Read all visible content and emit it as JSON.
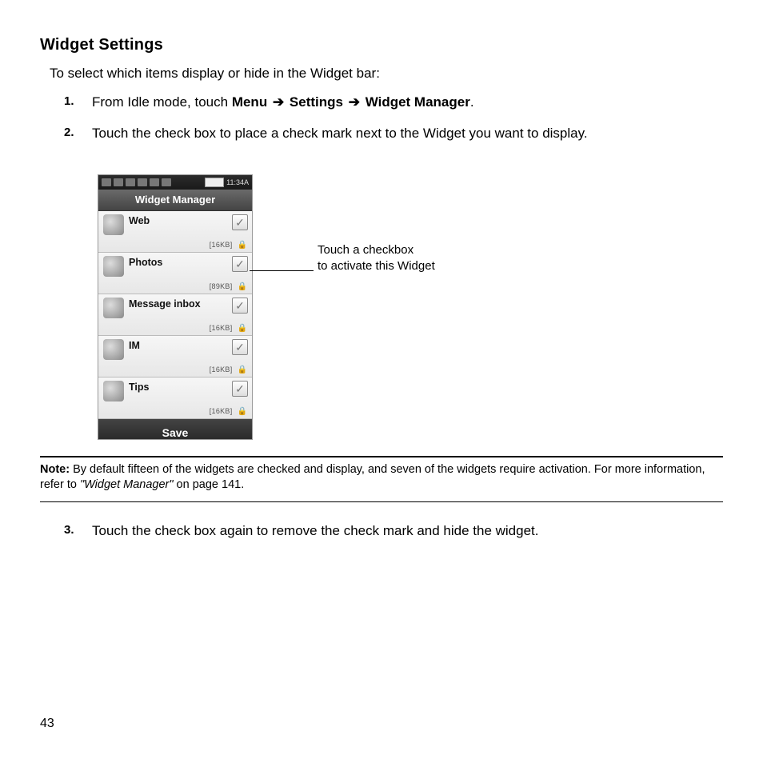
{
  "section": {
    "title": "Widget Settings",
    "intro": "To select which items display or hide in the Widget bar:"
  },
  "steps": {
    "s1_prefix": "From Idle mode, touch ",
    "menu": "Menu",
    "settings": "Settings",
    "wm": "Widget Manager",
    "s2": "Touch the check box to place a check mark next to the Widget you want to display.",
    "s3": "Touch the check box again to remove the check mark and hide the widget."
  },
  "phone": {
    "time": "11:34A",
    "title": "Widget Manager",
    "items": [
      {
        "label": "Web",
        "size": "[16KB]"
      },
      {
        "label": "Photos",
        "size": "[89KB]"
      },
      {
        "label": "Message inbox",
        "size": "[16KB]"
      },
      {
        "label": "IM",
        "size": "[16KB]"
      },
      {
        "label": "Tips",
        "size": "[16KB]"
      }
    ],
    "save": "Save"
  },
  "annotation": {
    "line1": "Touch a checkbox",
    "line2": "to activate this Widget"
  },
  "note": {
    "label": "Note:",
    "body_a": "By default fifteen of the widgets are checked and display, and seven of the widgets require activation. For more information, refer to ",
    "ref": "\"Widget Manager\"",
    "body_b": "  on page 141."
  },
  "pagenum": "43"
}
